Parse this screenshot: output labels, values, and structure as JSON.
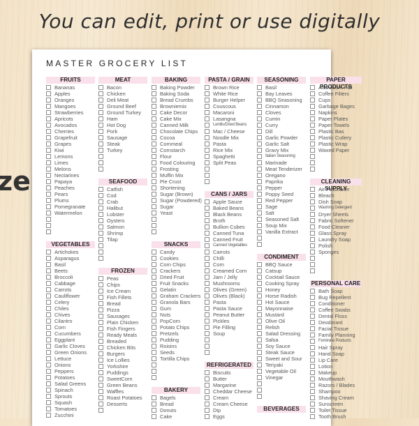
{
  "tagline": "You can edit, print or use digitally",
  "side_word": "ze",
  "sheet": {
    "title": "MASTER GROCERY LIST",
    "header_color": "#f9e0ea",
    "columns": [
      [
        {
          "title": "FRUITS",
          "items": [
            "Bananas",
            "Apples",
            "Oranges",
            "Mangoes",
            "Strawberries",
            "Apricots",
            "Avocados",
            "Cherries",
            "Grapefruit",
            "Grapes",
            "Kiwi",
            "Lemons",
            "Limes",
            "Melons",
            "Nectarines",
            "Papaya",
            "Peaches",
            "Pears",
            "Plums",
            "Pomegranate",
            "Watermelon",
            "",
            "",
            ""
          ]
        },
        {
          "title": "VEGETABLES",
          "items": [
            "Artichokes",
            "Asparagus",
            "Basil",
            "Beets",
            "Broccoli",
            "Cabbage",
            "Carrots",
            "Cauliflower",
            "Celery",
            "Chiles",
            "Chives",
            "Cilantro",
            "Corn",
            "Cucumbers",
            "Eggplant",
            "Garlic Cloves",
            "Green Onions",
            "Lettuce",
            "Onions",
            "Peppers",
            "Potatoes",
            "Salad Greens",
            "Spinach",
            "Sprouts",
            "Squash",
            "Tomatoes",
            "Zucchini"
          ]
        }
      ],
      [
        {
          "title": "MEAT",
          "items": [
            "Bacon",
            "Chicken",
            "Deli Meat",
            "Ground Beef",
            "Ground Turkey",
            "Ham",
            "Hot Dog",
            "Pork",
            "Sausage",
            "Steak",
            "Turkey",
            "",
            "",
            ""
          ]
        },
        {
          "title": "SEAFOOD",
          "items": [
            "Catfish",
            "Cod",
            "Crab",
            "Halibut",
            "Lobster",
            "Oysters",
            "Salmon",
            "Shrimp",
            "Tilap",
            "",
            "",
            ""
          ]
        },
        {
          "title": "FROZEN",
          "items": [
            "Peas",
            "Chips",
            "Ice Cream",
            "Fish Fillets",
            "Bread",
            "Pizza",
            "Sausages",
            "Plain Chicken",
            "Fish Fingers",
            "Ready Meals",
            "Breaded",
            "Chicken Bits",
            "Burgers",
            "Ice Lollies",
            "Yorkshire",
            "Puddings",
            "SweetCorn",
            "Green Beans",
            "Waffles",
            "Roast Potatoes",
            "Desserts",
            ""
          ]
        }
      ],
      [
        {
          "title": "BAKING",
          "items": [
            "Baking Powder",
            "Baking Soda",
            "Bread Crumbs",
            "Browniemix",
            "Cake Decor",
            "Cake Mix",
            "Canned Milk",
            "Chocolate Chips",
            "Cocoa",
            "Cornmeal",
            "Cornstarch",
            "Flour",
            "Food Colouring",
            "Frosting",
            "Muffin Mix",
            "Pie Crust",
            "Shortening",
            "Sugar (Brown)",
            "Sugar (Powdered)",
            "Sugar",
            "Yeast",
            "",
            "",
            ""
          ]
        },
        {
          "title": "SNACKS",
          "items": [
            "Candy",
            "Cookies",
            "Corn Chips",
            "Crackers",
            "Dried Fruit",
            "Fruit Snacks",
            "Gelatin",
            "Graham Crackers",
            "Granola Bars",
            "Gum",
            "Nuts",
            "PopCorn",
            "Potato Chips",
            "Pretzels",
            "Pudding",
            "Roisins",
            "Seeds",
            "Tortilla Chips",
            "",
            "",
            ""
          ]
        },
        {
          "title": "BAKERY",
          "items": [
            "Bagels",
            "Bread",
            "Donuts",
            "Cake"
          ]
        }
      ],
      [
        {
          "title": "PASTA / GRAIN",
          "items": [
            "Brown Rice",
            "White Rice",
            "Burger Helper",
            "Couscous",
            "Macaroni",
            "Lasangna",
            "Lentils/Dried Beans",
            "Mac / Cheese",
            "Noodle Mix",
            "Pasta",
            "Rice Mix",
            "Spaghetti",
            "Split Peas",
            "",
            "",
            ""
          ]
        },
        {
          "title": "CANS / JARS",
          "items": [
            "Apple Sauce",
            "Baked Beans",
            "Black Beans",
            "Broth",
            "Bullion Cubes",
            "Canned Tuna",
            "Canned Fruit",
            "Canned Vegetables",
            "Carrots",
            "Chilli",
            "Corn",
            "Creamed Corn",
            "Jam / Jelly",
            "Mushrooms",
            "Olives (Green)",
            "Olives (Black)",
            "Pasta",
            "Pasta Sauce",
            "Peanut Butter",
            "Pickles",
            "Pie Filling",
            "Soup",
            "",
            "",
            ""
          ]
        },
        {
          "title": "REFRIGERATED",
          "items": [
            "Biscuits",
            "Butter",
            "Margarine",
            "Cheddar Cheese",
            "Cream",
            "Cream Cheese",
            "Dip",
            "Eggs"
          ]
        }
      ],
      [
        {
          "title": "SEASONING",
          "items": [
            "Basil",
            "Bay Leaves",
            "BBQ Seasoning",
            "Cinnamon",
            "Cloves",
            "Cumin",
            "Curry",
            "Dill",
            "Garlic Powder",
            "Garlic Salt",
            "Gravy Mix",
            "Italian Seasoning",
            "Marinade",
            "Meat Tenderizer",
            "Oregano",
            "Paprika",
            "Pepper",
            "Poppy Seed",
            "Red Pepper",
            "Sage",
            "Salt",
            "Seasoned Salt",
            "Soup Mix",
            "Vanilla Extract",
            "",
            ""
          ]
        },
        {
          "title": "CONDIMENT",
          "items": [
            "BBQ Sauce",
            "Catsup",
            "Cocktail Sauce",
            "Cooking Spray",
            "Honey",
            "Horse Radish",
            "Hot Sauce",
            "Mayonnaise",
            "Mustard",
            "Olive Oil",
            "Relish",
            "Salad Dressing",
            "Salsa",
            "Soy Sauce",
            "Steak Sauce",
            "Sweet and Sour",
            "Teriyaki",
            "Vegetable Oil",
            "Vinegar",
            "",
            "",
            ""
          ]
        },
        {
          "title": "BEVERAGES",
          "items": []
        }
      ],
      [
        {
          "title": "PAPER PRODUCTS",
          "items": [
            "Aluminium Foil",
            "Coffee Filters",
            "Cups",
            "Garbage Bages",
            "Napkins",
            "Paper Plates",
            "Paper Towels",
            "Plastic Bas",
            "Plastic Cutlery",
            "Plastic Wrap",
            "Waxed Paper",
            "",
            "",
            ""
          ]
        },
        {
          "title": "CLEANING SUPPLY",
          "items": [
            "Air Freshener",
            "Bleach",
            "Dish Soap",
            "Washing Detergent",
            "Dryer Sheets",
            "Fabric Softener",
            "Food Cleaner",
            "Glass Spray",
            "Laundry Soap",
            "Polish",
            "Sponges",
            "",
            "",
            ""
          ]
        },
        {
          "title": "PERSONAL CARE",
          "items": [
            "Bath Soap",
            "Bug Repellent",
            "Conditioner",
            "Coffee Swabs",
            "Dental Floss",
            "Deodorant",
            "Facial Tissue",
            "Family Planning",
            "Feminine Products",
            "Hair Spray",
            "Hand Soap",
            "Lip Care",
            "Lotion",
            "Makeup",
            "Mouthwash",
            "Razors / Blades",
            "Shampoo",
            "Shaving Cream",
            "Sunscreen",
            "Toilet Tissue",
            "Tooth Brush"
          ]
        }
      ]
    ]
  }
}
